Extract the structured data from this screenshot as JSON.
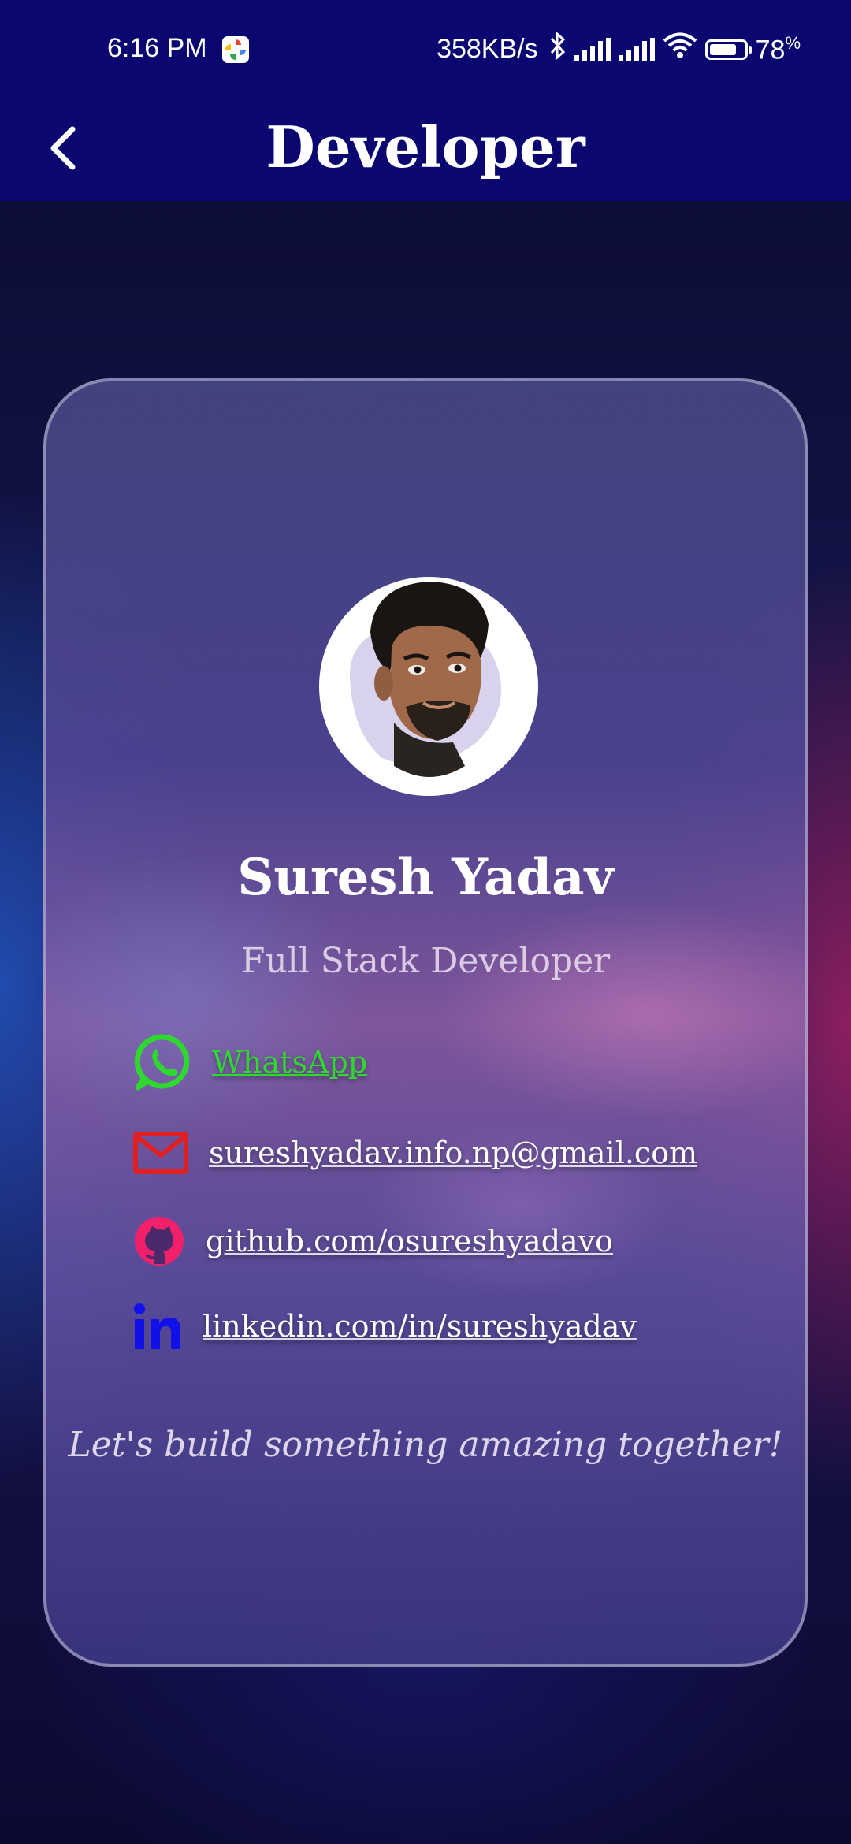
{
  "status_bar": {
    "time": "6:16 PM",
    "net_speed": "358KB/s",
    "battery_percent": "78",
    "battery_unit": "%",
    "battery_level": 0.78
  },
  "app_bar": {
    "title": "Developer",
    "back_icon": "chevron-left-icon"
  },
  "profile": {
    "name": "Suresh Yadav",
    "role": "Full Stack Developer",
    "avatar": "profile-photo"
  },
  "contacts": {
    "whatsapp": {
      "label": "WhatsApp",
      "icon": "whatsapp-icon",
      "color": "#2fd82f"
    },
    "email": {
      "label": "sureshyadav.info.np@gmail.com",
      "icon": "mail-icon",
      "color": "#e02020"
    },
    "github": {
      "label": "github.com/osureshyadavo",
      "icon": "github-icon",
      "color": "#f0206a"
    },
    "linkedin": {
      "label": "linkedin.com/in/sureshyadav",
      "icon": "linkedin-icon",
      "color": "#1010e8"
    }
  },
  "tagline": "Let's build something amazing together!",
  "colors": {
    "app_bar": "#0a0870",
    "accent_whatsapp": "#2fd82f"
  }
}
